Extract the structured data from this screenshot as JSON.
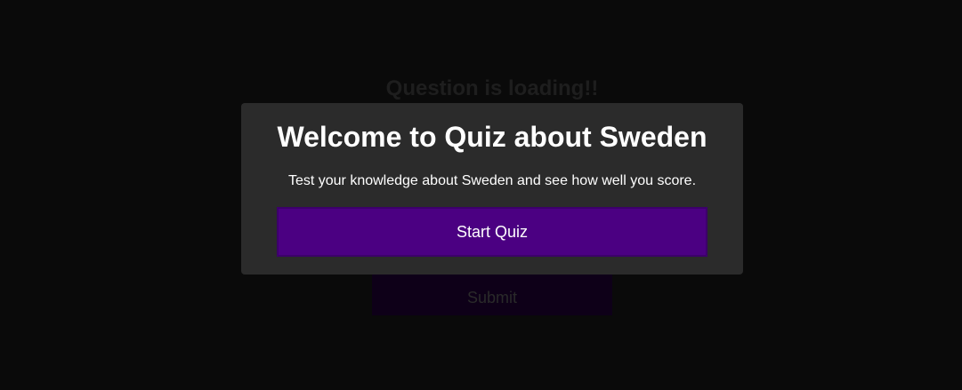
{
  "quiz": {
    "question_text": "Question is loading!!",
    "submit_label": "Submit"
  },
  "modal": {
    "title": "Welcome to Quiz about Sweden",
    "description": "Test your knowledge about Sweden and see how well you score.",
    "start_label": "Start Quiz"
  },
  "colors": {
    "background": "#000000",
    "modal_background": "#2b2b2b",
    "accent": "#4b0082"
  }
}
